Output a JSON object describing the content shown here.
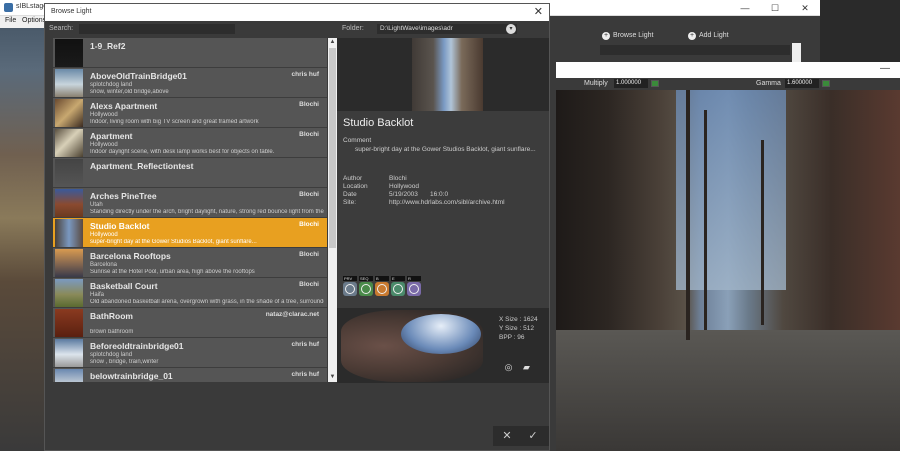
{
  "app": {
    "title": "sIBLstage",
    "menu": [
      "File",
      "Options"
    ],
    "right_panel": {
      "browse_light": "Browse Light",
      "add_light": "Add Light"
    }
  },
  "preview": {
    "multiply_label": "Multiply",
    "multiply_value": "1.000000",
    "gamma_label": "Gamma",
    "gamma_value": "1.600000",
    "close_icon": "minimize-icon"
  },
  "dialog": {
    "title": "Browse Light",
    "search_label": "Search:",
    "search_value": "",
    "folder_label": "Folder:",
    "folder_value": "D:\\LightWave\\images\\adr"
  },
  "items": [
    {
      "name": "1-9_Ref2",
      "author": "",
      "location": "",
      "desc": "",
      "thumb": "linear-gradient(180deg,#111,#1a1a1a)"
    },
    {
      "name": "AboveOldTrainBridge01",
      "author": "chris huf",
      "location": "splotchdog land",
      "desc": "snow, winter,old bridge,above",
      "thumb": "linear-gradient(180deg,#6a8aa8,#c8d4dc 55%,#8a8070)"
    },
    {
      "name": "Alexs Apartment",
      "author": "Blochi",
      "location": "Hollywood",
      "desc": "Indoor, living room with big TV screen and great framed artwork",
      "thumb": "linear-gradient(135deg,#6a4a30,#c8a870 50%,#3a2a20)"
    },
    {
      "name": "Apartment",
      "author": "Blochi",
      "location": "Hollywood",
      "desc": "Indoor daylight scene, with desk lamp works best for objects on table.",
      "thumb": "linear-gradient(135deg,#5a5040,#d8d0b8 45%,#4a4030)"
    },
    {
      "name": "Apartment_Reflectiontest",
      "author": "",
      "location": "",
      "desc": "",
      "thumb": "linear-gradient(180deg,#444,#555)"
    },
    {
      "name": "Arches PineTree",
      "author": "Blochi",
      "location": "Utah",
      "desc": "Standing directly under the arch, bright daylight, nature, strong red bounce light from the rocks",
      "thumb": "linear-gradient(180deg,#3a5a9a,#8a4a30 55%,#6a3a20)"
    },
    {
      "name": "Studio Backlot",
      "author": "Blochi",
      "location": "Hollywood",
      "desc": "super-bright day at the Gower Studios Backlot, giant sunflare...",
      "thumb": "linear-gradient(90deg,#4a4038,#7a98c0 50%,#5a4a40)",
      "selected": true
    },
    {
      "name": "Barcelona Rooftops",
      "author": "Blochi",
      "location": "Barcelona",
      "desc": "Sunrise at the Hotel Pool, urban area, high above the rooftops",
      "thumb": "linear-gradient(180deg,#d89a50,#8a6a50 50%,#3a3a4a)"
    },
    {
      "name": "Basketball Court",
      "author": "Blochi",
      "location": "Haifa",
      "desc": "Old abandoned basketball arena, overgrown with grass, in the shade of a tree, surrounded by houses",
      "thumb": "linear-gradient(180deg,#7a9ac0,#8a8a5a 55%,#5a6a30)"
    },
    {
      "name": "BathRoom",
      "author": "nataz@clarac.net",
      "location": "",
      "desc": "brown bathroom",
      "thumb": "linear-gradient(180deg,#8a3a20,#5a2010)"
    },
    {
      "name": "Beforeoldtrainbridge01",
      "author": "chris huf",
      "location": "splotchdog land",
      "desc": "snow , bridge, train,winter",
      "thumb": "linear-gradient(180deg,#5a7aa0,#dce4ec 55%,#9a9a9a)"
    },
    {
      "name": "belowtrainbridge_01",
      "author": "chris huf",
      "location": "splotchdog land",
      "desc": "",
      "thumb": "linear-gradient(180deg,#6a88b0,#c8d0d8 55%,#7a7a7a)"
    }
  ],
  "detail": {
    "title": "Studio Backlot",
    "comment_label": "Comment",
    "comment": "super-bright day at the Gower Studios Backlot, giant sunflare...",
    "author_label": "Author",
    "author": "Blochi",
    "location_label": "Location",
    "location": "Hollywood",
    "date_label": "Date",
    "date": "5/19/2003",
    "time": "16:0:0",
    "site_label": "Site:",
    "site": "http://www.hdrlabs.com/sibl/archive.html"
  },
  "badges": [
    {
      "label": "PRV",
      "color": "#6a7a8a"
    },
    {
      "label": "SEQ",
      "color": "#4a8a4a"
    },
    {
      "label": "B",
      "color": "#c87a30"
    },
    {
      "label": "E",
      "color": "#4a8a6a"
    },
    {
      "label": "R",
      "color": "#7a6aa8"
    }
  ],
  "pano": {
    "xsize": "X Size : 1624",
    "ysize": "Y Size : 512",
    "bpp": "BPP     : 96"
  },
  "footer": {
    "cancel": "✕",
    "ok": "✓"
  }
}
